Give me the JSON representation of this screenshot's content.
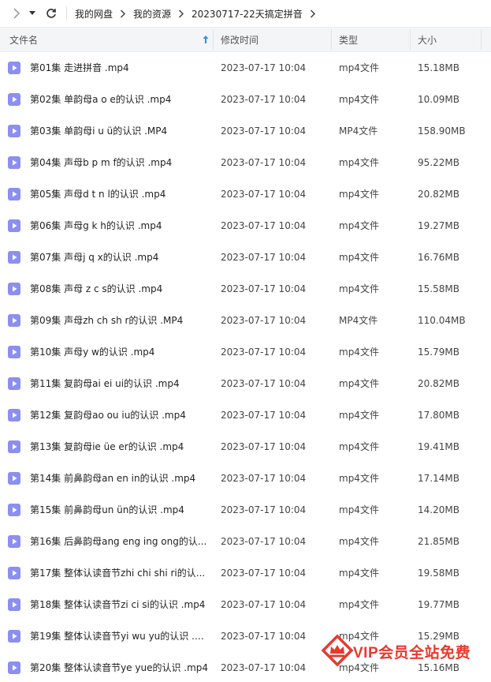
{
  "breadcrumb": [
    "我的网盘",
    "我的资源",
    "20230717-22天搞定拼音"
  ],
  "columns": {
    "name": "文件名",
    "modified": "修改时间",
    "type": "类型",
    "size": "大小"
  },
  "colors": {
    "file_icon": "#8c8ef0",
    "vip_red": "#e8392e",
    "header_bg": "#f4f5f7"
  },
  "files": [
    {
      "name": "第01集 走进拼音 .mp4",
      "date": "2023-07-17 10:04",
      "type": "mp4文件",
      "size": "15.18MB"
    },
    {
      "name": "第02集 单韵母a o e的认识 .mp4",
      "date": "2023-07-17 10:04",
      "type": "mp4文件",
      "size": "10.09MB"
    },
    {
      "name": "第03集 单韵母i u ü的认识 .MP4",
      "date": "2023-07-17 10:04",
      "type": "MP4文件",
      "size": "158.90MB"
    },
    {
      "name": "第04集 声母b p m f的认识 .mp4",
      "date": "2023-07-17 10:04",
      "type": "mp4文件",
      "size": "95.22MB"
    },
    {
      "name": "第05集 声母d t n l的认识 .mp4",
      "date": "2023-07-17 10:04",
      "type": "mp4文件",
      "size": "20.82MB"
    },
    {
      "name": "第06集 声母g k h的认识 .mp4",
      "date": "2023-07-17 10:04",
      "type": "mp4文件",
      "size": "19.27MB"
    },
    {
      "name": "第07集 声母j q x的认识 .mp4",
      "date": "2023-07-17 10:04",
      "type": "mp4文件",
      "size": "16.76MB"
    },
    {
      "name": "第08集 声母 z c s的认识 .mp4",
      "date": "2023-07-17 10:04",
      "type": "mp4文件",
      "size": "15.58MB"
    },
    {
      "name": "第09集 声母zh ch sh r的认识 .MP4",
      "date": "2023-07-17 10:04",
      "type": "MP4文件",
      "size": "110.04MB"
    },
    {
      "name": "第10集 声母y w的认识 .mp4",
      "date": "2023-07-17 10:04",
      "type": "mp4文件",
      "size": "15.79MB"
    },
    {
      "name": "第11集 复韵母ai ei ui的认识 .mp4",
      "date": "2023-07-17 10:04",
      "type": "mp4文件",
      "size": "20.82MB"
    },
    {
      "name": "第12集 复韵母ao ou iu的认识 .mp4",
      "date": "2023-07-17 10:04",
      "type": "mp4文件",
      "size": "17.80MB"
    },
    {
      "name": "第13集 复韵母ie üe er的认识 .mp4",
      "date": "2023-07-17 10:04",
      "type": "mp4文件",
      "size": "19.41MB"
    },
    {
      "name": "第14集 前鼻韵母an en in的认识 .mp4",
      "date": "2023-07-17 10:04",
      "type": "mp4文件",
      "size": "17.14MB"
    },
    {
      "name": "第15集 前鼻韵母un ün的认识 .mp4",
      "date": "2023-07-17 10:04",
      "type": "mp4文件",
      "size": "14.20MB"
    },
    {
      "name": "第16集 后鼻韵母ang eng ing ong的认...",
      "date": "2023-07-17 10:04",
      "type": "mp4文件",
      "size": "21.85MB"
    },
    {
      "name": "第17集 整体认读音节zhi chi shi ri的认...",
      "date": "2023-07-17 10:04",
      "type": "mp4文件",
      "size": "19.58MB"
    },
    {
      "name": "第18集 整体认读音节zi ci si的认识 .mp4",
      "date": "2023-07-17 10:04",
      "type": "mp4文件",
      "size": "19.77MB"
    },
    {
      "name": "第19集 整体认读音节yi wu yu的认识 .m...",
      "date": "2023-07-17 10:04",
      "type": "mp4文件",
      "size": "15.29MB"
    },
    {
      "name": "第20集 整体认读音节ye yue的认识 .mp4",
      "date": "2023-07-17 10:04",
      "type": "mp4文件",
      "size": "15.16MB"
    }
  ],
  "vip_badge": {
    "text": "VIP会员全站免费"
  }
}
